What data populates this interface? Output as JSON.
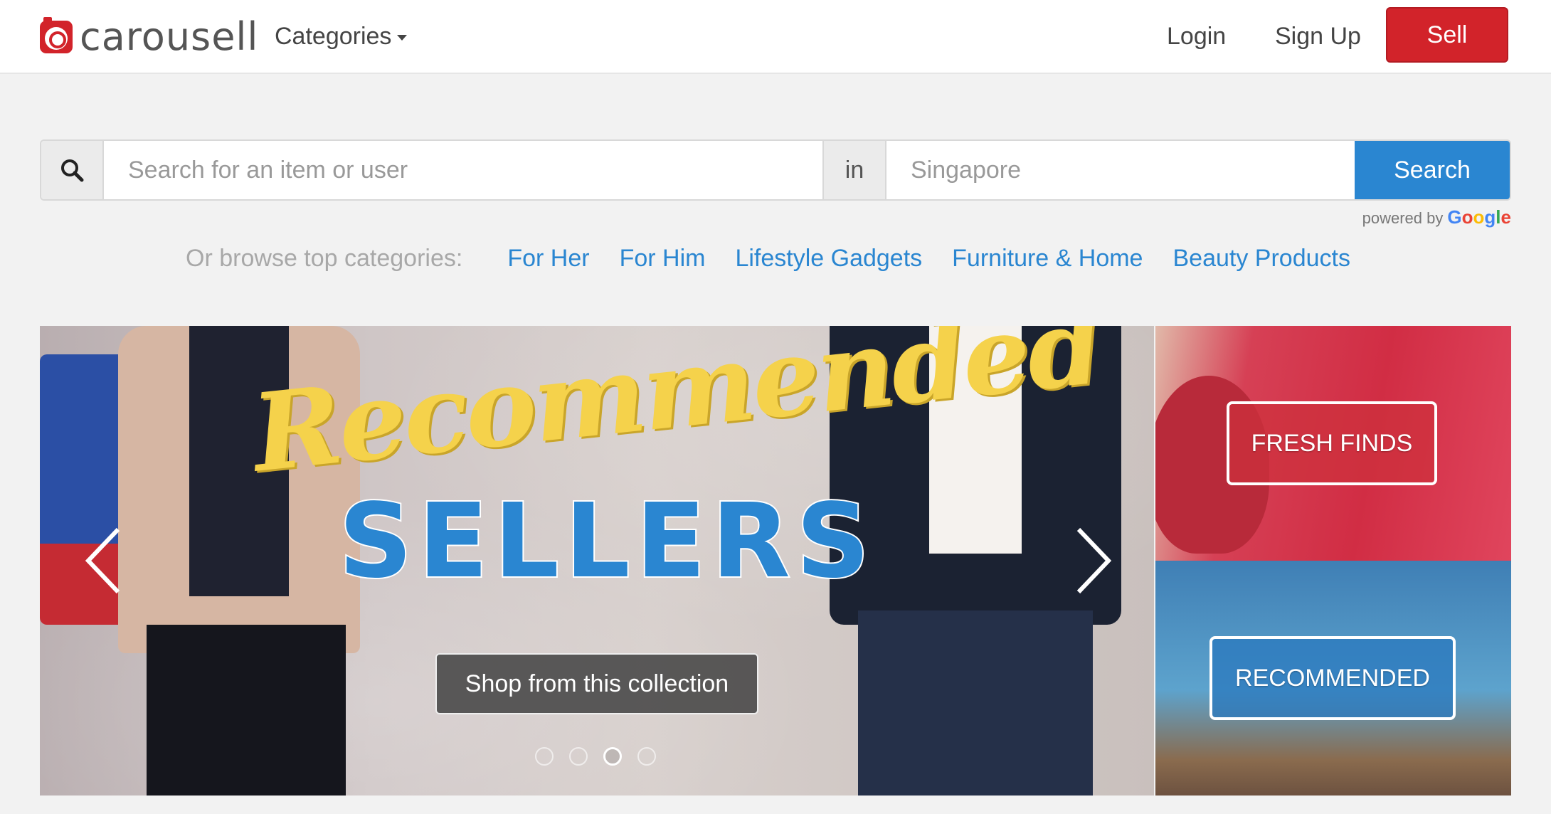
{
  "header": {
    "logo_text": "carousell",
    "categories_label": "Categories",
    "login_label": "Login",
    "signup_label": "Sign Up",
    "sell_label": "Sell"
  },
  "search": {
    "item_placeholder": "Search for an item or user",
    "in_label": "in",
    "location_placeholder": "Singapore",
    "button_label": "Search",
    "powered_by": "powered by",
    "google": [
      "G",
      "o",
      "o",
      "g",
      "l",
      "e"
    ]
  },
  "browse": {
    "label": "Or browse top categories:",
    "links": [
      "For Her",
      "For Him",
      "Lifestyle Gadgets",
      "Furniture & Home",
      "Beauty Products"
    ]
  },
  "hero": {
    "script_text": "Recommended",
    "big_text": "SELLERS",
    "cta_label": "Shop from this collection",
    "slide_count": 4,
    "active_slide": 3
  },
  "tiles": {
    "top_label": "FRESH FINDS",
    "bottom_label": "RECOMMENDED"
  },
  "colors": {
    "brand_red": "#d2232a",
    "link_blue": "#2a86d1"
  }
}
